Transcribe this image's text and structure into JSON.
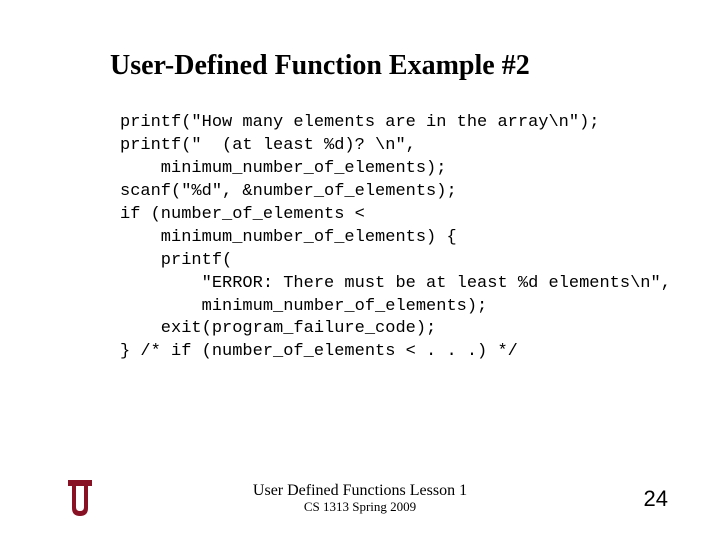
{
  "title": "User-Defined Function Example #2",
  "code": "printf(\"How many elements are in the array\\n\");\nprintf(\"  (at least %d)? \\n\",\n    minimum_number_of_elements);\nscanf(\"%d\", &number_of_elements);\nif (number_of_elements <\n    minimum_number_of_elements) {\n    printf(\n        \"ERROR: There must be at least %d elements\\n\",\n        minimum_number_of_elements);\n    exit(program_failure_code);\n} /* if (number_of_elements < . . .) */",
  "footer": {
    "line1": "User Defined Functions Lesson 1",
    "line2": "CS 1313 Spring 2009"
  },
  "page_number": "24",
  "logo": {
    "name": "ou-logo",
    "color": "#881124"
  }
}
